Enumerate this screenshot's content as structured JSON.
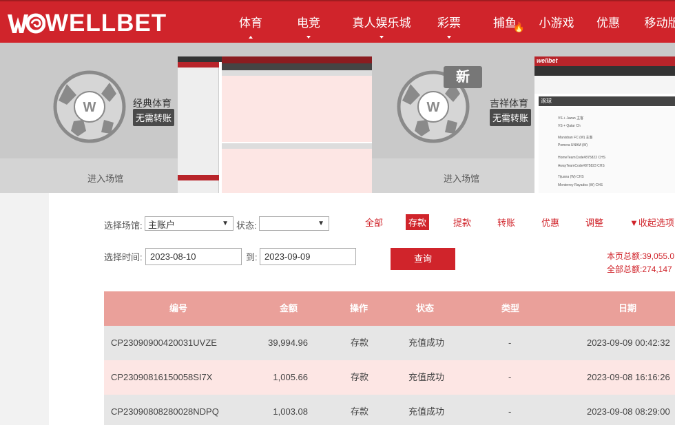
{
  "brand": {
    "name": "WELLBET",
    "color": "#d0242b"
  },
  "nav": [
    {
      "label": "体育",
      "caret": "up"
    },
    {
      "label": "电竞",
      "caret": "down"
    },
    {
      "label": "真人娱乐城",
      "caret": "down"
    },
    {
      "label": "彩票",
      "caret": "down"
    },
    {
      "label": "捕鱼",
      "caret": "",
      "hot": true
    },
    {
      "label": "小游戏",
      "caret": ""
    },
    {
      "label": "优惠",
      "caret": ""
    },
    {
      "label": "移动版",
      "caret": ""
    }
  ],
  "venues": [
    {
      "name": "经典体育",
      "tag": "无需转账",
      "enter": "进入场馆",
      "badge": ""
    },
    {
      "name": "吉祥体育",
      "tag": "无需转账",
      "enter": "进入场馆",
      "badge": "新"
    }
  ],
  "preview2": {
    "brand": "wellbet",
    "section": "滚球",
    "team_rows": [
      "VS + Jazan 主客",
      "VS + Qatar Ch",
      "Manisban FC (W) 主客",
      "Pomera UNAM (W)",
      "HomeTeamCode#875822 CHS",
      "AwayTeamCode#875823 CHS",
      "Tijuana (W) CHS",
      "Monterrey Rayados (W) CHS"
    ]
  },
  "filters": {
    "venue_label": "选择场馆:",
    "venue_value": "主账户",
    "status_label": "状态:",
    "status_value": "",
    "time_label": "选择时间:",
    "date_from": "2023-08-10",
    "to_label": "到:",
    "date_to": "2023-09-09",
    "query_label": "查询",
    "types": [
      "全部",
      "存款",
      "提款",
      "转账",
      "优惠",
      "调整"
    ],
    "active_type": "存款",
    "collapse_label": "▼收起选项"
  },
  "totals": {
    "page_total_label": "本页总额:",
    "page_total_value": "39,055.0",
    "all_total_label": "全部总额:",
    "all_total_value": "274,147"
  },
  "table": {
    "headers": [
      "编号",
      "金额",
      "操作",
      "状态",
      "类型",
      "日期"
    ],
    "rows": [
      {
        "id": "CP23090900420031UVZE",
        "amount": "39,994.96",
        "op": "存款",
        "status": "充值成功",
        "type": "-",
        "date": "2023-09-09 00:42:32"
      },
      {
        "id": "CP23090816150058SI7X",
        "amount": "1,005.66",
        "op": "存款",
        "status": "充值成功",
        "type": "-",
        "date": "2023-09-08 16:16:26"
      },
      {
        "id": "CP23090808280028NDPQ",
        "amount": "1,003.08",
        "op": "存款",
        "status": "充值成功",
        "type": "-",
        "date": "2023-09-08 08:29:00"
      }
    ]
  }
}
